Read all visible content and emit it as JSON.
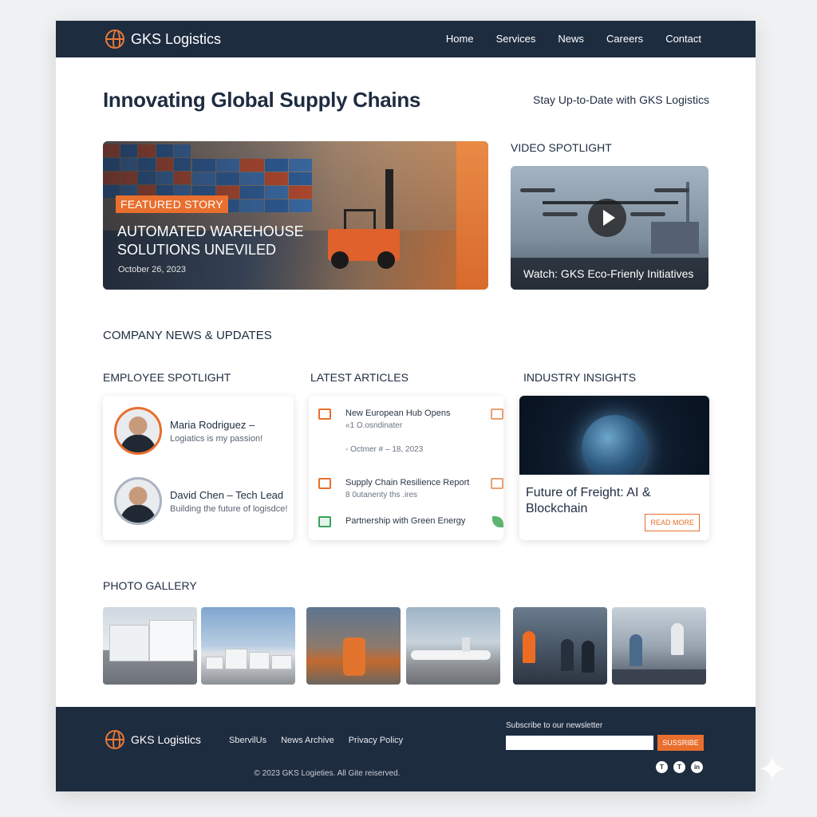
{
  "header": {
    "brand": "GKS Logistics",
    "nav": [
      "Home",
      "Services",
      "News",
      "Careers",
      "Contact"
    ]
  },
  "hero": {
    "title": "Innovating Global Supply Chains",
    "side_text": "Stay Up-to-Date with GKS Logistics"
  },
  "featured": {
    "badge": "FEATURED STORY",
    "headline": "AUTOMATED WAREHOUSE SOLUTIONS UNEVILED",
    "date": "October 26, 2023"
  },
  "video": {
    "label": "VIDEO SPOTLIGHT",
    "caption": "Watch: GKS Eco-Frienly Initiatives"
  },
  "news": {
    "section_title": "COMPANY NEWS & UPDATES",
    "employee": {
      "heading": "EMPLOYEE SPOTLIGHT",
      "people": [
        {
          "name": "Maria Rodriguez –",
          "subtitle": "Logiatics is my passion!"
        },
        {
          "name": "David Chen – Tech Lead",
          "subtitle": "Building the future of logisdce!"
        }
      ]
    },
    "articles": {
      "heading": "LATEST ARTICLES",
      "items": [
        {
          "title": "New European Hub Opens",
          "sub": "«1 O.osndinater",
          "date": "- Octmer # – 18, 2023",
          "icon": "map-icon",
          "right_icon": "chart-icon"
        },
        {
          "title": "Supply Chain Resilience Report",
          "sub": "8 0utanenty ths .ires",
          "date": "",
          "icon": "report-icon",
          "right_icon": "document-icon"
        },
        {
          "title": "Partnership with Green Energy",
          "sub": "",
          "date": "",
          "icon": "energy-icon",
          "right_icon": "leaf-icon"
        }
      ]
    },
    "insights": {
      "heading": "INDUSTRY INSIGHTS",
      "title": "Future of Freight: AI & Blockchain",
      "button": "READ MORE"
    }
  },
  "gallery": {
    "heading": "PHOTO GALLERY"
  },
  "footer": {
    "brand": "GKS Logistics",
    "links": [
      "SbervilUs",
      "News Archive",
      "Privacy Policy"
    ],
    "newsletter_label": "Subscribe to our newsletter",
    "newsletter_placeholder": "",
    "subscribe_button": "SUSSRIBE",
    "social": [
      "T",
      "T",
      "in"
    ],
    "copyright": "© 2023 GKS Logieties. All Gite reiserved."
  },
  "colors": {
    "navy": "#1e2c40",
    "accent": "#e86f2d",
    "green": "#3aa35c"
  }
}
